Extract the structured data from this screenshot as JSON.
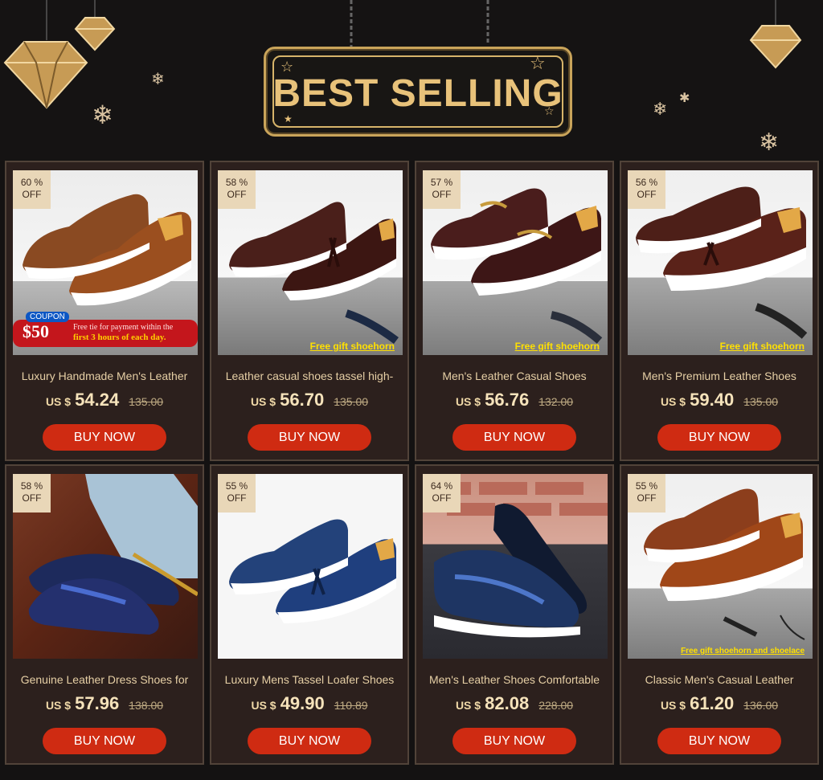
{
  "header": {
    "title": "BEST SELLING"
  },
  "colors": {
    "accent_gold": "#e8c27a",
    "card_bg": "#2c201d",
    "buy_button": "#cf2b12"
  },
  "products": [
    {
      "discount": "60 %",
      "off": "OFF",
      "name": "Luxury Handmade Men's Leather",
      "currency": "US $",
      "price": "54.24",
      "old_price": "135.00",
      "buy": "BUY NOW",
      "coupon": {
        "tag": "COUPON",
        "amount": "$50",
        "line1": "Free tie for payment within the",
        "line2": "first 3 hours of each day."
      }
    },
    {
      "discount": "58 %",
      "off": "OFF",
      "name": "Leather casual shoes tassel high-",
      "currency": "US $",
      "price": "56.70",
      "old_price": "135.00",
      "buy": "BUY NOW",
      "note": "Free gift shoehorn"
    },
    {
      "discount": "57 %",
      "off": "OFF",
      "name": "Men's Leather Casual Shoes",
      "currency": "US $",
      "price": "56.76",
      "old_price": "132.00",
      "buy": "BUY NOW",
      "note": "Free gift shoehorn"
    },
    {
      "discount": "56 %",
      "off": "OFF",
      "name": "Men's Premium Leather Shoes",
      "currency": "US $",
      "price": "59.40",
      "old_price": "135.00",
      "buy": "BUY NOW",
      "note": "Free gift shoehorn"
    },
    {
      "discount": "58 %",
      "off": "OFF",
      "name": "Genuine Leather Dress Shoes for",
      "currency": "US $",
      "price": "57.96",
      "old_price": "138.00",
      "buy": "BUY NOW"
    },
    {
      "discount": "55 %",
      "off": "OFF",
      "name": "Luxury Mens Tassel Loafer Shoes",
      "currency": "US $",
      "price": "49.90",
      "old_price": "110.89",
      "buy": "BUY NOW"
    },
    {
      "discount": "64 %",
      "off": "OFF",
      "name": "Men's Leather Shoes Comfortable",
      "currency": "US $",
      "price": "82.08",
      "old_price": "228.00",
      "buy": "BUY NOW"
    },
    {
      "discount": "55 %",
      "off": "OFF",
      "name": "Classic Men's Casual Leather",
      "currency": "US $",
      "price": "61.20",
      "old_price": "136.00",
      "buy": "BUY NOW",
      "note": "Free gift shoehorn and shoelace"
    }
  ]
}
